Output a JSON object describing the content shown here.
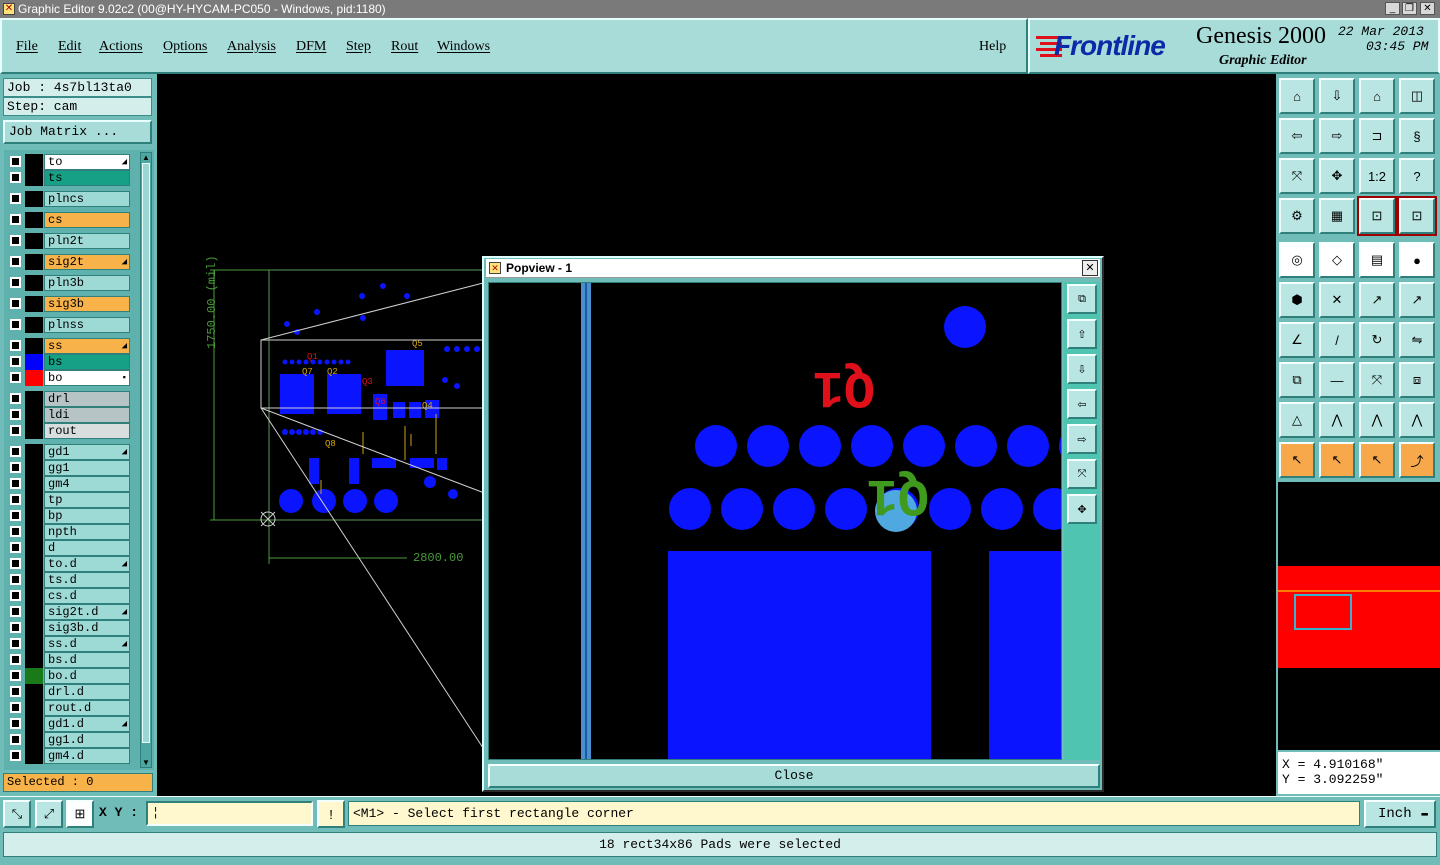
{
  "window": {
    "title": "Graphic Editor 9.02c2 (00@HY-HYCAM-PC050 - Windows, pid:1180)"
  },
  "menu": [
    "File",
    "Edit",
    "Actions",
    "Options",
    "Analysis",
    "DFM",
    "Step",
    "Rout",
    "Windows"
  ],
  "help": "Help",
  "brand": {
    "logo": "Frontline",
    "product": "Genesis 2000",
    "subtitle": "Graphic Editor",
    "date": "22 Mar 2013",
    "time": "03:45 PM"
  },
  "job": {
    "job_label": "Job : 4s7bl13ta0",
    "step_label": "Step: cam",
    "matrix_button": "Job Matrix ..."
  },
  "layers": [
    {
      "name": "to",
      "bg": "#ffffff",
      "color": "#000000",
      "mark": "◢"
    },
    {
      "name": "ts",
      "bg": "#16a085",
      "color": "#000000",
      "mark": ""
    },
    {
      "name": "plncs",
      "bg": "#9dd9d5",
      "color": "#000000",
      "mark": ""
    },
    {
      "name": "cs",
      "bg": "#f7b24a",
      "color": "#000000",
      "mark": ""
    },
    {
      "name": "pln2t",
      "bg": "#9dd9d5",
      "color": "#000000",
      "mark": ""
    },
    {
      "name": "sig2t",
      "bg": "#f7b24a",
      "color": "#000000",
      "mark": "◢"
    },
    {
      "name": "pln3b",
      "bg": "#9dd9d5",
      "color": "#000000",
      "mark": ""
    },
    {
      "name": "sig3b",
      "bg": "#f7b24a",
      "color": "#000000",
      "mark": ""
    },
    {
      "name": "plnss",
      "bg": "#9dd9d5",
      "color": "#000000",
      "mark": ""
    },
    {
      "name": "ss",
      "bg": "#f7b24a",
      "color": "#000000",
      "mark": "◢"
    },
    {
      "name": "bs",
      "bg": "#16a085",
      "color": "#0000ff",
      "mark": ""
    },
    {
      "name": "bo",
      "bg": "#ffffff",
      "color": "#ff0000",
      "mark": "▪"
    },
    {
      "name": "drl",
      "bg": "#b6c4c6",
      "color": "#000000",
      "mark": ""
    },
    {
      "name": "ldi",
      "bg": "#b6c4c6",
      "color": "#000000",
      "mark": ""
    },
    {
      "name": "rout",
      "bg": "#d8dede",
      "color": "#000000",
      "mark": ""
    },
    {
      "name": "gd1",
      "bg": "#9dd9d5",
      "color": "#000000",
      "mark": "◢"
    },
    {
      "name": "gg1",
      "bg": "#9dd9d5",
      "color": "#000000",
      "mark": ""
    },
    {
      "name": "gm4",
      "bg": "#9dd9d5",
      "color": "#000000",
      "mark": ""
    },
    {
      "name": "tp",
      "bg": "#9dd9d5",
      "color": "#000000",
      "mark": ""
    },
    {
      "name": "bp",
      "bg": "#9dd9d5",
      "color": "#000000",
      "mark": ""
    },
    {
      "name": "npth",
      "bg": "#9dd9d5",
      "color": "#000000",
      "mark": ""
    },
    {
      "name": "d",
      "bg": "#9dd9d5",
      "color": "#000000",
      "mark": ""
    },
    {
      "name": "to.d",
      "bg": "#9dd9d5",
      "color": "#000000",
      "mark": "◢"
    },
    {
      "name": "ts.d",
      "bg": "#9dd9d5",
      "color": "#000000",
      "mark": ""
    },
    {
      "name": "cs.d",
      "bg": "#9dd9d5",
      "color": "#000000",
      "mark": ""
    },
    {
      "name": "sig2t.d",
      "bg": "#9dd9d5",
      "color": "#000000",
      "mark": "◢"
    },
    {
      "name": "sig3b.d",
      "bg": "#9dd9d5",
      "color": "#000000",
      "mark": ""
    },
    {
      "name": "ss.d",
      "bg": "#9dd9d5",
      "color": "#000000",
      "mark": "◢"
    },
    {
      "name": "bs.d",
      "bg": "#9dd9d5",
      "color": "#000000",
      "mark": ""
    },
    {
      "name": "bo.d",
      "bg": "#9dd9d5",
      "color": "#1a7a1a",
      "mark": ""
    },
    {
      "name": "drl.d",
      "bg": "#9dd9d5",
      "color": "#000000",
      "mark": ""
    },
    {
      "name": "rout.d",
      "bg": "#9dd9d5",
      "color": "#000000",
      "mark": ""
    },
    {
      "name": "gd1.d",
      "bg": "#9dd9d5",
      "color": "#000000",
      "mark": "◢"
    },
    {
      "name": "gg1.d",
      "bg": "#9dd9d5",
      "color": "#000000",
      "mark": ""
    },
    {
      "name": "gm4.d",
      "bg": "#9dd9d5",
      "color": "#000000",
      "mark": ""
    }
  ],
  "selected_label": "Selected : 0",
  "canvas": {
    "dim_vertical": "1750.00 (mil)",
    "dim_horizontal": "2800.00",
    "silk_labels": [
      "Q1",
      "Q2",
      "Q3",
      "Q5",
      "Q6",
      "Q4",
      "Q8",
      "Q7"
    ]
  },
  "popview": {
    "title": "Popview - 1",
    "close_label": "Close",
    "label_red": "Q1",
    "label_green": "Q1"
  },
  "toolbar_labels": {
    "ratio": "1:2"
  },
  "coords": {
    "x": "X = 4.910168\"",
    "y": "Y = 3.092259\""
  },
  "bottom": {
    "xy_label": "X Y :",
    "prompt": "<M1> - Select first rectangle corner",
    "units": "Inch",
    "status": "18 rect34x86 Pads were selected"
  },
  "colors": {
    "pad": "#0a14ff",
    "silk_red": "#e0101a",
    "silk_green": "#3f9a1e",
    "highlight": "#4fa8e0",
    "panel": "#6fbcb8"
  }
}
